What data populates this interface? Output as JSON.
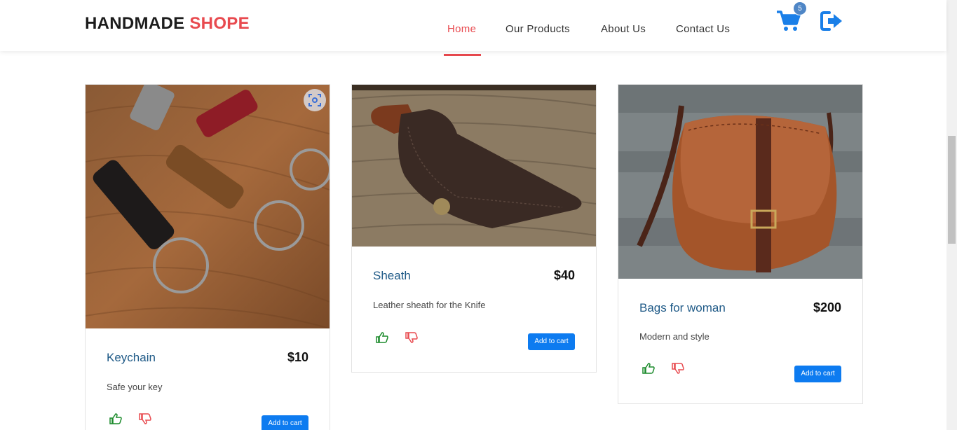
{
  "header": {
    "brand_main": "HANDMADE",
    "brand_accent": "SHOPE",
    "nav": [
      {
        "label": "Home",
        "active": true
      },
      {
        "label": "Our Products",
        "active": false
      },
      {
        "label": "About Us",
        "active": false
      },
      {
        "label": "Contact Us",
        "active": false
      }
    ],
    "cart_icon": "shopping-cart-icon",
    "cart_count": "5",
    "logout_icon": "sign-out-icon"
  },
  "products": [
    {
      "name": "Keychain",
      "price": "$10",
      "description": "Safe your key",
      "add_label": "Add to cart"
    },
    {
      "name": "Sheath",
      "price": "$40",
      "description": "Leather sheath for the Knife",
      "add_label": "Add to cart"
    },
    {
      "name": "Bags for woman",
      "price": "$200",
      "description": "Modern and style",
      "add_label": "Add to cart"
    }
  ],
  "icons": {
    "like": "thumbs-up-icon",
    "dislike": "thumbs-down-icon",
    "lens": "visual-search-icon"
  },
  "colors": {
    "accent": "#e84a4f",
    "primary": "#0d7bf0",
    "title": "#1f5a87",
    "like": "#1a8a2a",
    "dislike": "#e84a4f",
    "cart": "#1a7fe8"
  }
}
